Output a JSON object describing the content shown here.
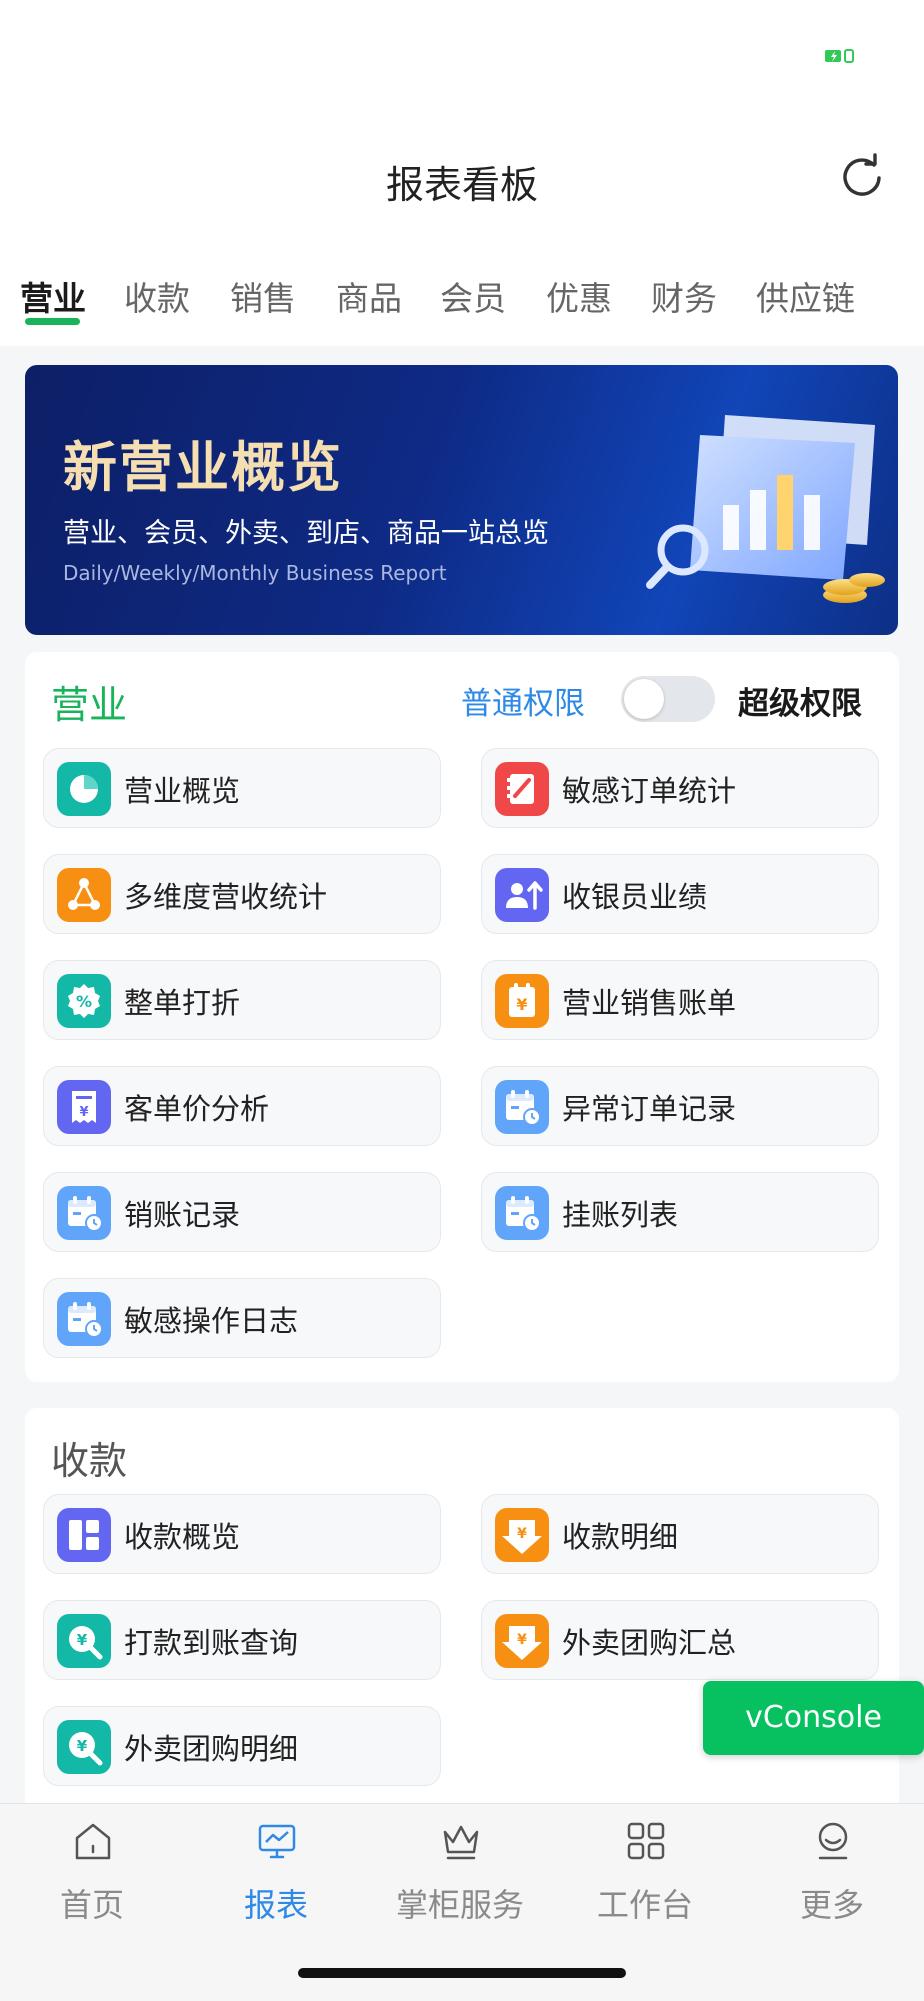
{
  "header": {
    "title": "报表看板"
  },
  "tabs": [
    {
      "label": "营业",
      "active": true
    },
    {
      "label": "收款"
    },
    {
      "label": "销售"
    },
    {
      "label": "商品"
    },
    {
      "label": "会员"
    },
    {
      "label": "优惠"
    },
    {
      "label": "财务"
    },
    {
      "label": "供应链"
    }
  ],
  "banner": {
    "title": "新营业概览",
    "subtitle": "营业、会员、外卖、到店、商品一站总览",
    "english": "Daily/Weekly/Monthly Business Report"
  },
  "business": {
    "title": "营业",
    "perm_normal": "普通权限",
    "perm_super": "超级权限",
    "toggle_on": false,
    "items": [
      {
        "label": "营业概览",
        "icon": "pie-chart-icon",
        "color": "#14b8a6"
      },
      {
        "label": "敏感订单统计",
        "icon": "edit-note-icon",
        "color": "#f04848"
      },
      {
        "label": "多维度营收统计",
        "icon": "network-icon",
        "color": "#f79012"
      },
      {
        "label": "收银员业绩",
        "icon": "cashier-performance-icon",
        "color": "#6366f1"
      },
      {
        "label": "整单打折",
        "icon": "discount-icon",
        "color": "#14b8a6"
      },
      {
        "label": "营业销售账单",
        "icon": "sales-bill-icon",
        "color": "#f79012"
      },
      {
        "label": "客单价分析",
        "icon": "receipt-icon",
        "color": "#6366f1"
      },
      {
        "label": "异常订单记录",
        "icon": "calendar-clock-icon",
        "color": "#60a5fa"
      },
      {
        "label": "销账记录",
        "icon": "calendar-clock-icon",
        "color": "#60a5fa"
      },
      {
        "label": "挂账列表",
        "icon": "calendar-clock-icon",
        "color": "#60a5fa"
      },
      {
        "label": "敏感操作日志",
        "icon": "calendar-clock-icon",
        "color": "#60a5fa"
      }
    ]
  },
  "payments": {
    "title": "收款",
    "items": [
      {
        "label": "收款概览",
        "icon": "dashboard-icon",
        "color": "#6366f1"
      },
      {
        "label": "收款明细",
        "icon": "yuan-download-icon",
        "color": "#f79012"
      },
      {
        "label": "打款到账查询",
        "icon": "yuan-search-icon",
        "color": "#14b8a6"
      },
      {
        "label": "外卖团购汇总",
        "icon": "yuan-download-icon",
        "color": "#f79012"
      },
      {
        "label": "外卖团购明细",
        "icon": "yuan-search-icon",
        "color": "#14b8a6"
      }
    ]
  },
  "vconsole": {
    "label": "vConsole"
  },
  "tabbar": [
    {
      "label": "首页",
      "icon": "home-icon"
    },
    {
      "label": "报表",
      "icon": "report-icon",
      "active": true
    },
    {
      "label": "掌柜服务",
      "icon": "crown-icon"
    },
    {
      "label": "工作台",
      "icon": "grid-icon"
    },
    {
      "label": "更多",
      "icon": "more-icon"
    }
  ],
  "colors": {
    "accent": "#19b35c",
    "link": "#2e8ae6",
    "vconsole": "#07c160"
  }
}
